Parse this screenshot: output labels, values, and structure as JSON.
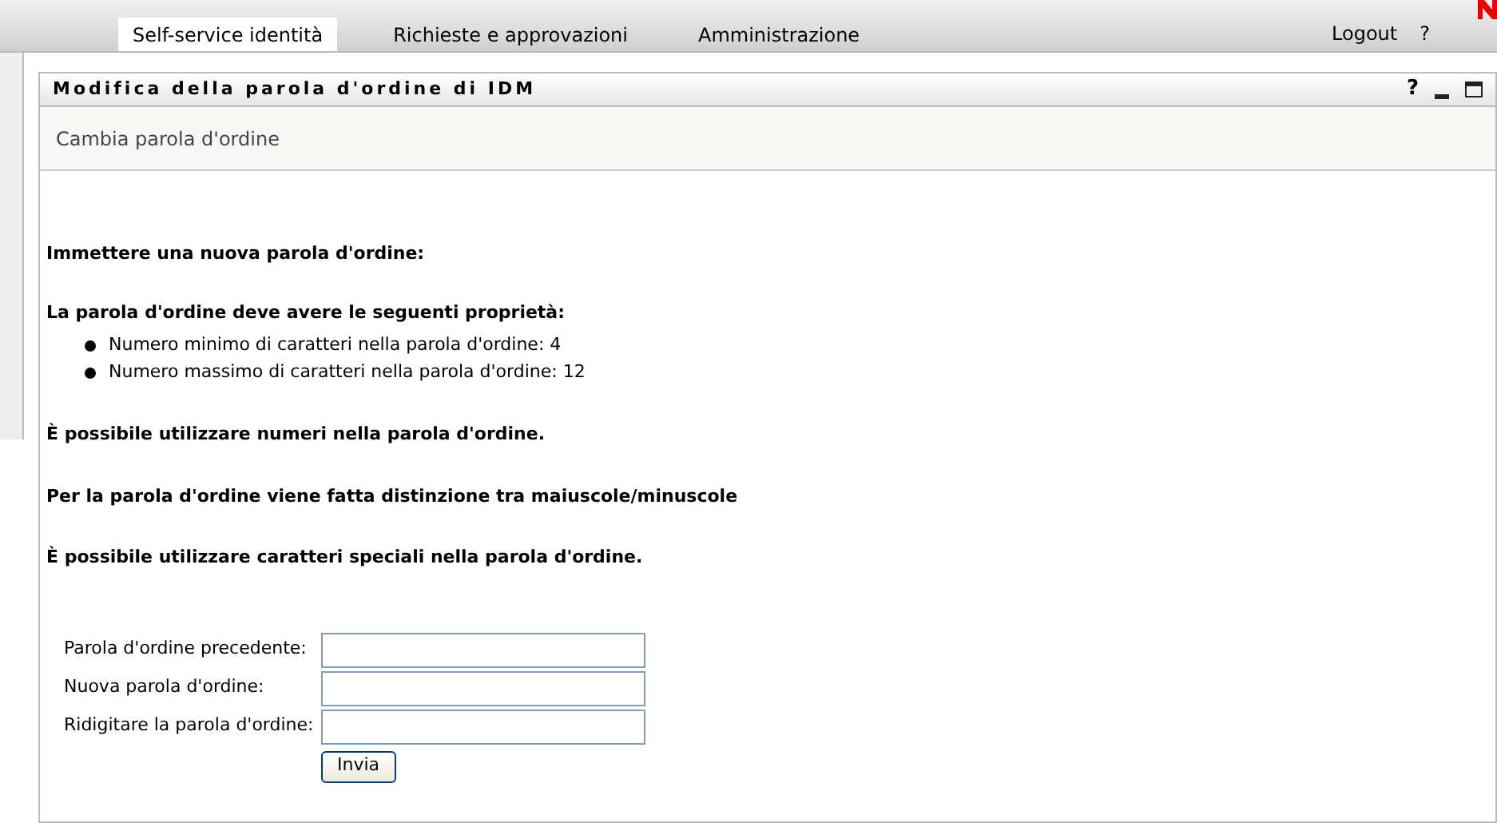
{
  "nav": {
    "tabs": [
      {
        "label": "Self-service identità",
        "selected": true
      },
      {
        "label": "Richieste e approvazioni",
        "selected": false
      },
      {
        "label": "Amministrazione",
        "selected": false
      }
    ],
    "links": [
      "Logout",
      "?"
    ]
  },
  "panel": {
    "title": "Modifica della parola d'ordine di IDM",
    "controls": [
      "?"
    ],
    "subtitle": "Cambia parola d'ordine",
    "intro": "Immettere una nuova parola d'ordine:",
    "rules_heading": "La parola d'ordine deve avere le seguenti proprietà:",
    "rules": [
      "Numero minimo di caratteri nella parola d'ordine: 4",
      "Numero massimo di caratteri nella parola d'ordine: 12"
    ],
    "notes": [
      "È possibile utilizzare numeri nella parola d'ordine.",
      "Per la parola d'ordine viene fatta distinzione tra maiuscole/minuscole",
      "È possibile utilizzare caratteri speciali nella parola d'ordine."
    ],
    "fields": [
      {
        "label": "Parola d'ordine precedente:"
      },
      {
        "label": "Nuova parola d'ordine:"
      },
      {
        "label": "Ridigitare la parola d'ordine:"
      }
    ],
    "submit": "Invia"
  }
}
